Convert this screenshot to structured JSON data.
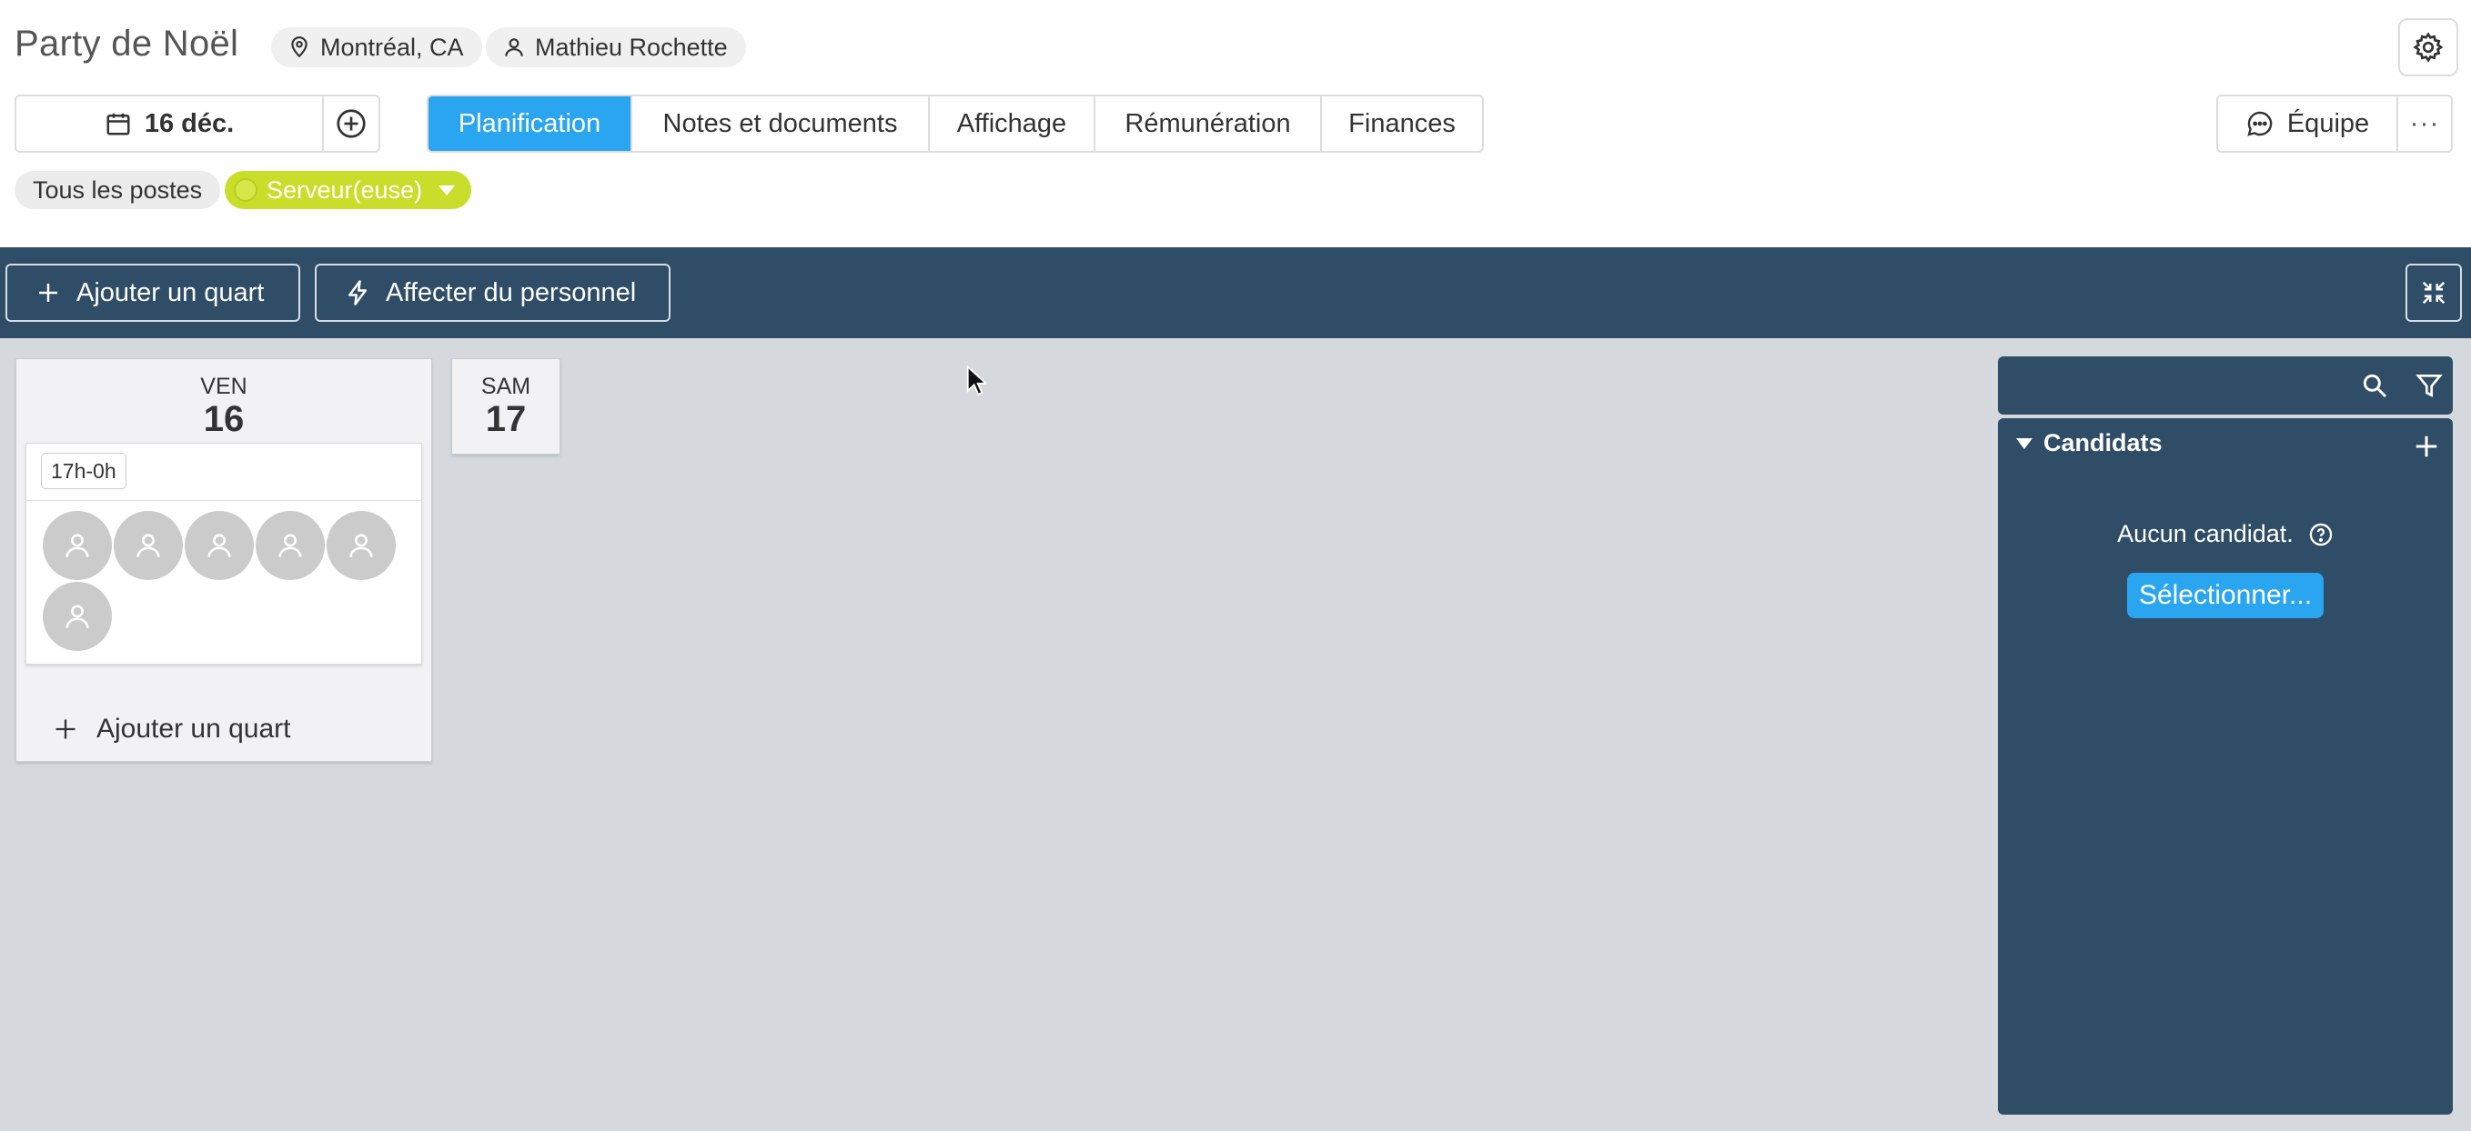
{
  "header": {
    "title": "Party de Noël",
    "location": "Montréal, CA",
    "manager": "Mathieu Rochette",
    "date": "16 déc.",
    "tabs": [
      {
        "label": "Planification",
        "active": true
      },
      {
        "label": "Notes et documents",
        "active": false
      },
      {
        "label": "Affichage",
        "active": false
      },
      {
        "label": "Rémunération",
        "active": false
      },
      {
        "label": "Finances",
        "active": false
      }
    ],
    "team_label": "Équipe",
    "more_label": "···"
  },
  "filters": {
    "all_label": "Tous les postes",
    "role_label": "Serveur(euse)",
    "role_color": "#c9de2a"
  },
  "toolbar": {
    "add_shift_label": "Ajouter un quart",
    "assign_staff_label": "Affecter du personnel"
  },
  "schedule": {
    "days": [
      {
        "day_name": "VEN",
        "day_number": "16",
        "shifts": [
          {
            "time": "17h-0h",
            "empty_slots": 6
          }
        ],
        "add_shift_label": "Ajouter un quart"
      },
      {
        "day_name": "SAM",
        "day_number": "17",
        "shifts": []
      }
    ]
  },
  "side_panel": {
    "section_title": "Candidats",
    "empty_text": "Aucun candidat.",
    "select_label": "Sélectionner..."
  },
  "colors": {
    "accent": "#2aa5f0",
    "toolbar_bg": "#2f4d66",
    "canvas_bg": "#d5d9dd"
  }
}
